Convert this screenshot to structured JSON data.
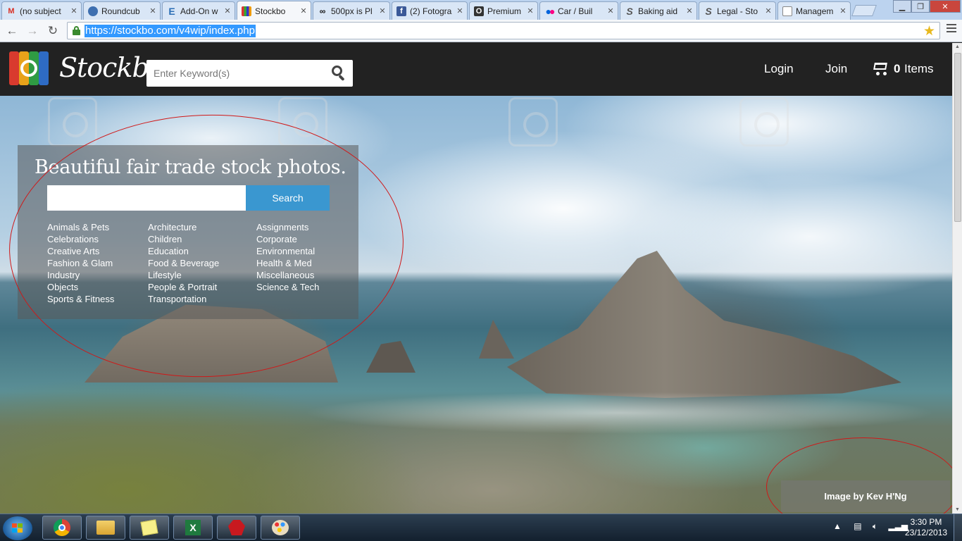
{
  "browser": {
    "tabs": [
      {
        "label": "(no subject",
        "icon": "gmail-icon"
      },
      {
        "label": "Roundcub",
        "icon": "roundcube-icon"
      },
      {
        "label": "Add-On w",
        "icon": "e-icon"
      },
      {
        "label": "Stockbo",
        "icon": "stockbo-icon",
        "active": true
      },
      {
        "label": "500px is Pl",
        "icon": "500px-icon"
      },
      {
        "label": "(2) Fotogra",
        "icon": "facebook-icon"
      },
      {
        "label": "Premium",
        "icon": "premium-icon"
      },
      {
        "label": "Car / Buil",
        "icon": "flickr-icon"
      },
      {
        "label": "Baking aid",
        "icon": "s-icon"
      },
      {
        "label": "Legal - Sto",
        "icon": "s-icon"
      },
      {
        "label": "Managem",
        "icon": "document-icon"
      }
    ],
    "url": "https://stockbo.com/v4wip/index.php"
  },
  "site": {
    "logo_text": "Stockbo",
    "search_placeholder": "Enter Keyword(s)",
    "nav": {
      "login": "Login",
      "join": "Join",
      "cart_count": "0",
      "cart_label": "Items"
    }
  },
  "hero": {
    "headline": "Beautiful fair trade stock photos.",
    "search_button": "Search",
    "categories": [
      [
        "Animals & Pets",
        "Celebrations",
        "Creative Arts",
        "Fashion & Glam",
        "Industry",
        "Objects",
        "Sports & Fitness"
      ],
      [
        "Architecture",
        "Children",
        "Education",
        "Food & Beverage",
        "Lifestyle",
        "People & Portrait",
        "Transportation"
      ],
      [
        "Assignments",
        "Corporate",
        "Environmental",
        "Health & Med",
        "Miscellaneous",
        "Science & Tech"
      ]
    ],
    "credit": "Image by Kev H'Ng"
  },
  "taskbar": {
    "apps": [
      "chrome-icon",
      "file-explorer-icon",
      "sticky-notes-icon",
      "excel-icon",
      "red-app-icon",
      "paint-icon"
    ],
    "time": "3:30 PM",
    "date": "23/12/2013"
  },
  "colors": {
    "header_bg": "#222222",
    "search_button": "#3a97d0",
    "annotation": "#d01818"
  }
}
